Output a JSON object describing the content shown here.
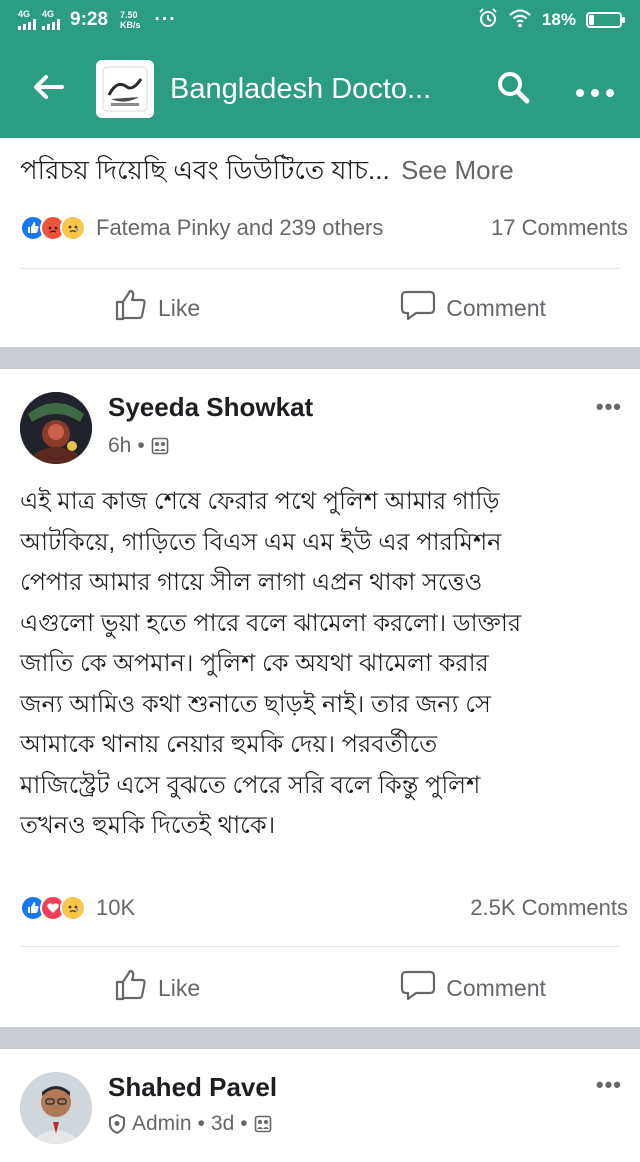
{
  "status_bar": {
    "network_1": "4G",
    "network_2": "4G",
    "time": "9:28",
    "speed_value": "7.50",
    "speed_unit": "KB/s",
    "more": "···",
    "battery": "18%",
    "battery_level": 0.18
  },
  "app_bar": {
    "title": "Bangladesh Docto...",
    "back_icon": "back-arrow-icon",
    "search_icon": "search-icon",
    "menu_icon": "more-icon"
  },
  "post1": {
    "snippet": "পরিচয় দিয়েছি এবং ডিউটিতে যাচ...",
    "see_more": "See More",
    "reaction_text": "Fatema Pinky and 239 others",
    "comments": "17 Comments",
    "like_label": "Like",
    "comment_label": "Comment"
  },
  "post2": {
    "author": "Syeeda Showkat",
    "time": "6h",
    "body_lines": [
      "এই মাত্র কাজ শেষে ফেরার পথে পুলিশ আমার গাড়ি",
      "আটকিয়ে,   গাড়িতে বিএস এম এম ইউ এর পারমিশন",
      "পেপার আমার গায়ে সীল লাগা এপ্রন থাকা সত্তেও",
      "এগুলো  ভুয়া হতে পারে বলে ঝামেলা করলো। ডাক্তার",
      "জাতি কে অপমান। পুলিশ কে অযথা ঝামেলা করার",
      "জন্য আমিও কথা শুনাতে ছাড়ই নাই। তার জন্য সে",
      "আমাকে থানায় নেয়ার হুমকি দেয়। পরবর্তীতে",
      "মাজিস্ট্রেট এসে বুঝতে পেরে সরি বলে কিন্তু পুলিশ",
      "তখনও হুমকি দিতেই থাকে।"
    ],
    "reaction_count": "10K",
    "comments": "2.5K Comments",
    "like_label": "Like",
    "comment_label": "Comment",
    "menu": "•••"
  },
  "post3": {
    "author": "Shahed Pavel",
    "role": "Admin",
    "time": "3d",
    "menu": "•••"
  },
  "colors": {
    "brand": "#2a9d82",
    "like_blue": "#1877f2",
    "muted": "#65676b"
  }
}
